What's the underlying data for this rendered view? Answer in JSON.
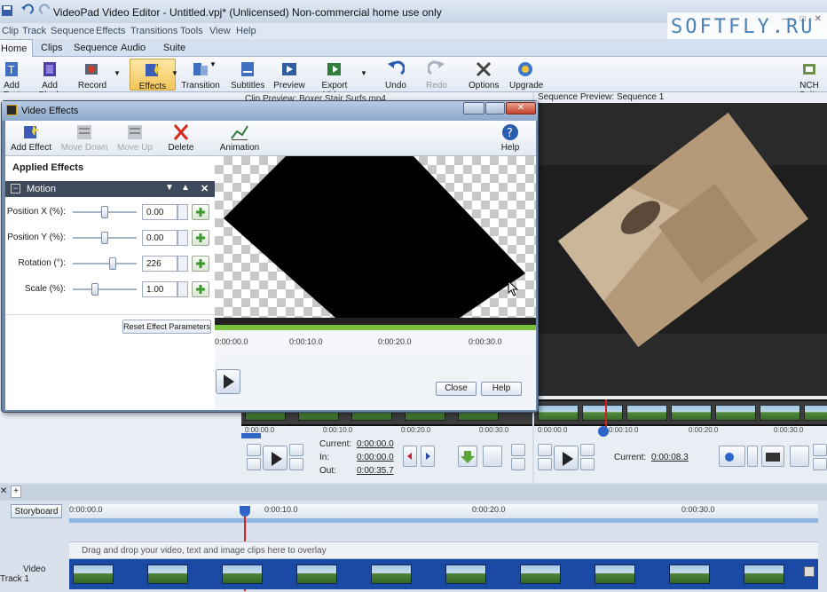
{
  "window": {
    "title": "VideoPad Video Editor - Untitled.vpj* (Unlicensed) Non-commercial home use only"
  },
  "menu": [
    "Clip",
    "Track",
    "Sequence",
    "Effects",
    "Transitions",
    "Tools",
    "View",
    "Help"
  ],
  "watermark": {
    "text": "SOFTFLY.RU"
  },
  "ribbon_tabs": [
    "Home",
    "Clips",
    "Sequence",
    "Audio",
    "Suite"
  ],
  "ribbon": {
    "add_text": "Add Text",
    "add_blank": "Add Blank",
    "record": "Record",
    "effects": "Effects",
    "transition": "Transition",
    "subtitles": "Subtitles",
    "preview": "Preview",
    "export_video": "Export Video",
    "undo": "Undo",
    "redo": "Redo",
    "options": "Options",
    "upgrade": "Upgrade",
    "nch_suite": "NCH Suite"
  },
  "clip_preview": {
    "header": "Clip Preview: Boxer Stair Surfs.mp4",
    "ruler": [
      "0:00:00.0",
      "0:00:10.0",
      "0:00:20.0",
      "0:00:30.0"
    ],
    "current_label": "Current:",
    "current": "0:00:00.0",
    "in_label": "In:",
    "in": "0:00:00.0",
    "out_label": "Out:",
    "out": "0:00:35.7"
  },
  "sequence_preview": {
    "header": "Sequence Preview: Sequence 1",
    "ruler": [
      "0:00:00.0",
      "0:00:10.0",
      "0:00:20.0",
      "0:00:30.0"
    ],
    "current_label": "Current:",
    "current": "0:00:08.3"
  },
  "dialog": {
    "title": "Video Effects",
    "toolbar": {
      "add_effect": "Add Effect",
      "move_down": "Move Down",
      "move_up": "Move Up",
      "delete": "Delete",
      "animation": "Animation",
      "help": "Help"
    },
    "applied_effects": "Applied Effects",
    "effect_name": "Motion",
    "params": [
      {
        "label": "Position X (%):",
        "value": "0.00",
        "level": 0.5
      },
      {
        "label": "Position Y (%):",
        "value": "0.00",
        "level": 0.5
      },
      {
        "label": "Rotation (°):",
        "value": "226",
        "level": 0.63
      },
      {
        "label": "Scale (%):",
        "value": "1.00",
        "level": 0.35
      }
    ],
    "reset": "Reset Effect Parameters",
    "ruler": [
      "0:00:00.0",
      "0:00:10.0",
      "0:00:20.0",
      "0:00:30.0"
    ],
    "close": "Close",
    "help": "Help"
  },
  "timeline": {
    "storyboard": "Storyboard",
    "ruler": [
      "0:00:00.0",
      "0:00:10.0",
      "0:00:20.0",
      "0:00:30.0"
    ],
    "overlay_hint": "Drag and drop your video, text and image clips here to overlay",
    "video_track": "Video Track 1"
  },
  "colors": {
    "accent": "#f4c657",
    "effect_header": "#3e4a5c",
    "track_blue": "#1a4aa3",
    "progress_green": "#7bbf3e"
  }
}
